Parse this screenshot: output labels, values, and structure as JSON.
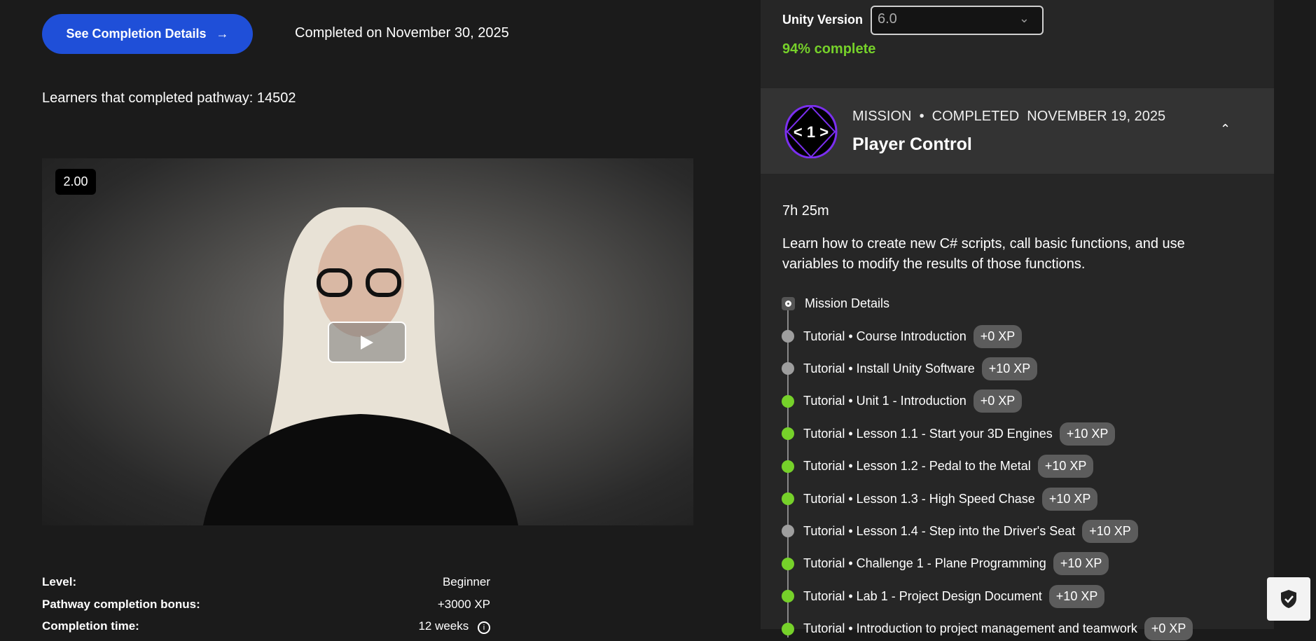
{
  "header": {
    "button_label": "See Completion Details",
    "arrow": "→",
    "completed_text": "Completed on November 30, 2025",
    "learners_text": "Learners that completed pathway: 14502"
  },
  "video": {
    "speed": "2.00"
  },
  "details": [
    {
      "label": "Level:",
      "value": "Beginner"
    },
    {
      "label": "Pathway completion bonus:",
      "value": "+3000 XP"
    },
    {
      "label": "Completion time:",
      "value": "12 weeks"
    }
  ],
  "panel": {
    "unity_label": "Unity Version",
    "unity_value": "6.0",
    "progress_text": "94% complete",
    "progress_percent": 94
  },
  "mission": {
    "meta": "MISSION  •  COMPLETED  NOVEMBER 19, 2025",
    "title": "Player Control",
    "icon_text": "< 1 >",
    "duration": "7h 25m",
    "description": "Learn how to create new C# scripts, call basic functions, and use variables to modify the results of those functions.",
    "details_label": "Mission Details"
  },
  "colors": {
    "done": "#76d12a",
    "pending": "#9e9e9e",
    "accent": "#1f4fd8"
  },
  "items": [
    {
      "label": "Tutorial • Course Introduction",
      "xp": "+0 XP",
      "status": "pending"
    },
    {
      "label": "Tutorial • Install Unity Software",
      "xp": "+10 XP",
      "status": "pending"
    },
    {
      "label": "Tutorial • Unit 1 - Introduction",
      "xp": "+0 XP",
      "status": "done"
    },
    {
      "label": "Tutorial • Lesson 1.1 - Start your 3D Engines",
      "xp": "+10 XP",
      "status": "done"
    },
    {
      "label": "Tutorial • Lesson 1.2 - Pedal to the Metal",
      "xp": "+10 XP",
      "status": "done"
    },
    {
      "label": "Tutorial • Lesson 1.3 - High Speed Chase",
      "xp": "+10 XP",
      "status": "done"
    },
    {
      "label": "Tutorial • Lesson 1.4 - Step into the Driver's Seat",
      "xp": "+10 XP",
      "status": "pending"
    },
    {
      "label": "Tutorial • Challenge 1 - Plane Programming",
      "xp": "+10 XP",
      "status": "done"
    },
    {
      "label": "Tutorial • Lab 1 - Project Design Document",
      "xp": "+10 XP",
      "status": "done"
    },
    {
      "label": "Tutorial • Introduction to project management and teamwork",
      "xp": "+0 XP",
      "status": "done"
    }
  ]
}
